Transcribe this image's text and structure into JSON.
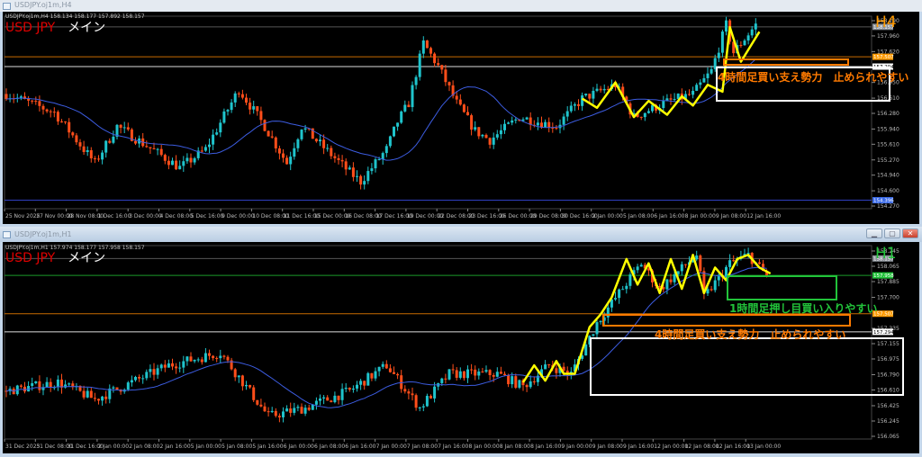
{
  "colors": {
    "bull": "#1fc4cc",
    "bear": "#ff4e1a",
    "ma": "#3c5ce0",
    "zigzag": "#ffff00",
    "orange": "#ff7a00",
    "green": "#22c33a",
    "white": "#ffffff",
    "grid": "#555555"
  },
  "top": {
    "window_title": "USDJPY.oj1m,H4",
    "info": "USDJPY.oj1m,H4  158.134 158.177 157.892 158.157",
    "symbol": "USD JPY",
    "label": "メイン",
    "timeframe": "H4",
    "price_ticks": [
      "158.290",
      "157.960",
      "157.620",
      "156.950",
      "156.610",
      "156.280",
      "155.940",
      "155.610",
      "155.270",
      "154.940",
      "154.600",
      "154.270"
    ],
    "price_range": [
      154.27,
      158.29
    ],
    "levels": [
      {
        "price": 158.157,
        "text": "158.157",
        "kind": "bid"
      },
      {
        "price": 157.507,
        "text": "157.507",
        "kind": "orange"
      },
      {
        "price": 157.294,
        "text": "157.294",
        "kind": "white"
      },
      {
        "price": 154.396,
        "text": "154.396",
        "kind": "blue"
      }
    ],
    "annotation": "4時間足買い支え勢力　止められやすい",
    "time_labels": [
      "25 Nov 2025",
      "27 Nov 00:00",
      "28 Nov 08:00",
      "1 Dec 16:00",
      "3 Dec 00:00",
      "4 Dec 08:00",
      "5 Dec 16:00",
      "9 Dec 00:00",
      "10 Dec 08:00",
      "11 Dec 16:00",
      "15 Dec 00:00",
      "16 Dec 08:00",
      "17 Dec 16:00",
      "19 Dec 00:00",
      "22 Dec 08:00",
      "23 Dec 16:00",
      "26 Dec 00:00",
      "29 Dec 08:00",
      "30 Dec 16:00",
      "2 Jan 00:00",
      "5 Jan 08:00",
      "6 Jan 16:00",
      "8 Jan 00:00",
      "9 Jan 08:00",
      "12 Jan 16:00"
    ],
    "path": [
      [
        0,
        156.7
      ],
      [
        13,
        156.3
      ],
      [
        24,
        155.2
      ],
      [
        30,
        156.0
      ],
      [
        47,
        155.1
      ],
      [
        54,
        155.5
      ],
      [
        63,
        156.8
      ],
      [
        70,
        156.0
      ],
      [
        76,
        155.2
      ],
      [
        80,
        156.0
      ],
      [
        93,
        155.0
      ],
      [
        96,
        154.8
      ],
      [
        103,
        155.5
      ],
      [
        106,
        156.1
      ],
      [
        109,
        156.5
      ],
      [
        113,
        157.8
      ],
      [
        117,
        157.3
      ],
      [
        122,
        156.5
      ],
      [
        127,
        155.9
      ],
      [
        131,
        155.7
      ],
      [
        139,
        156.2
      ],
      [
        149,
        156.0
      ],
      [
        156,
        156.6
      ],
      [
        165,
        156.9
      ],
      [
        170,
        156.2
      ],
      [
        178,
        156.5
      ],
      [
        186,
        156.7
      ],
      [
        191,
        157.2
      ],
      [
        195,
        158.2
      ],
      [
        197,
        157.6
      ],
      [
        203,
        158.2
      ]
    ],
    "zigzag": [
      [
        156,
        156.6
      ],
      [
        160,
        156.4
      ],
      [
        165,
        156.95
      ],
      [
        170,
        156.2
      ],
      [
        174,
        156.55
      ],
      [
        179,
        156.25
      ],
      [
        183,
        156.65
      ],
      [
        186,
        156.45
      ],
      [
        190,
        156.9
      ],
      [
        194,
        156.75
      ],
      [
        196,
        158.15
      ],
      [
        199,
        157.4
      ],
      [
        204,
        158.05
      ]
    ]
  },
  "bottom": {
    "window_title": "USDJPY.oj1m,H1",
    "info": "USDJPY.oj1m,H1  157.974 158.177 157.958 158.157",
    "symbol": "USD JPY",
    "label": "メイン",
    "timeframe": "H1",
    "price_ticks": [
      "158.245",
      "158.065",
      "157.885",
      "157.700",
      "157.335",
      "157.155",
      "156.975",
      "156.790",
      "156.610",
      "156.425",
      "156.245",
      "156.065"
    ],
    "price_range": [
      156.065,
      158.245
    ],
    "levels": [
      {
        "price": 158.157,
        "text": "158.157",
        "kind": "bid"
      },
      {
        "price": 157.958,
        "text": "157.958",
        "kind": "green"
      },
      {
        "price": 157.507,
        "text": "157.507",
        "kind": "orange"
      },
      {
        "price": 157.294,
        "text": "157.294",
        "kind": "white"
      }
    ],
    "annotation_green": "1時間足押し目買い入りやすい",
    "annotation_orange": "4時間足買い支え勢力　止められやすい",
    "time_labels": [
      "31 Dec 2025",
      "31 Dec 08:00",
      "31 Dec 16:00",
      "2 Jan 00:00",
      "2 Jan 08:00",
      "2 Jan 16:00",
      "5 Jan 00:00",
      "5 Jan 08:00",
      "5 Jan 16:00",
      "6 Jan 00:00",
      "6 Jan 08:00",
      "6 Jan 16:00",
      "7 Jan 00:00",
      "7 Jan 08:00",
      "7 Jan 16:00",
      "8 Jan 00:00",
      "8 Jan 08:00",
      "8 Jan 16:00",
      "9 Jan 00:00",
      "9 Jan 08:00",
      "9 Jan 16:00",
      "12 Jan 00:00",
      "12 Jan 08:00",
      "12 Jan 16:00",
      "13 Jan 00:00"
    ],
    "path": [
      [
        0,
        156.6
      ],
      [
        14,
        156.7
      ],
      [
        24,
        156.5
      ],
      [
        44,
        156.9
      ],
      [
        58,
        157.05
      ],
      [
        71,
        156.3
      ],
      [
        81,
        156.4
      ],
      [
        93,
        156.6
      ],
      [
        103,
        156.9
      ],
      [
        112,
        156.4
      ],
      [
        120,
        156.8
      ],
      [
        133,
        156.8
      ],
      [
        140,
        156.65
      ],
      [
        147,
        156.9
      ],
      [
        153,
        156.8
      ],
      [
        160,
        157.4
      ],
      [
        172,
        158.1
      ],
      [
        177,
        157.8
      ],
      [
        187,
        158.2
      ],
      [
        189,
        157.7
      ],
      [
        196,
        158.1
      ],
      [
        201,
        158.2
      ],
      [
        206,
        157.95
      ]
    ],
    "zigzag": [
      [
        140,
        156.7
      ],
      [
        143,
        156.9
      ],
      [
        146,
        156.72
      ],
      [
        149,
        156.95
      ],
      [
        151,
        156.8
      ],
      [
        154,
        156.8
      ],
      [
        158,
        157.35
      ],
      [
        161,
        157.5
      ],
      [
        164,
        157.7
      ],
      [
        168,
        158.15
      ],
      [
        171,
        157.85
      ],
      [
        174,
        158.1
      ],
      [
        177,
        157.75
      ],
      [
        180,
        158.15
      ],
      [
        183,
        157.8
      ],
      [
        186,
        158.2
      ],
      [
        189,
        157.75
      ],
      [
        192,
        158.05
      ],
      [
        195,
        157.9
      ],
      [
        198,
        158.15
      ],
      [
        201,
        158.2
      ],
      [
        204,
        158.05
      ],
      [
        207,
        157.98
      ]
    ]
  },
  "window_buttons": {
    "min": "▁",
    "max": "▢",
    "close": "✕"
  }
}
